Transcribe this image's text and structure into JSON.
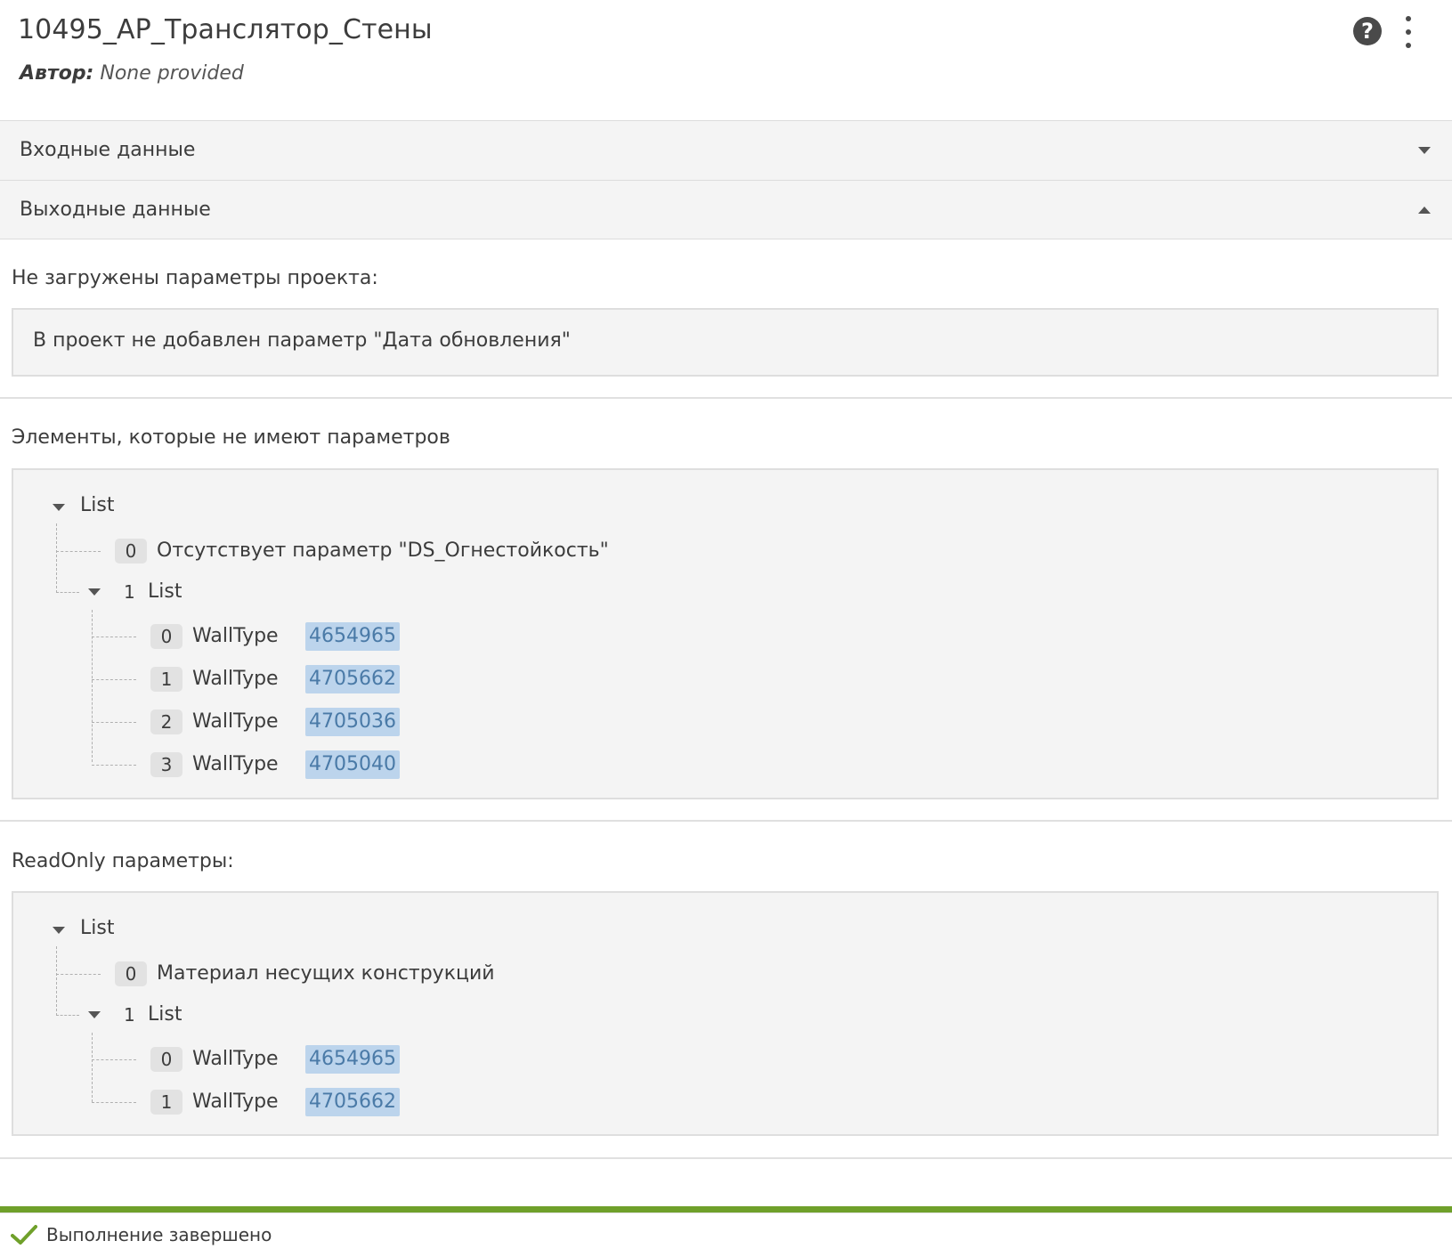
{
  "header": {
    "title": "10495_АР_Транслятор_Стены",
    "author_label": "Автор:",
    "author_value": "None provided"
  },
  "accordion": {
    "inputs_label": "Входные данные",
    "outputs_label": "Выходные данные"
  },
  "outputs": {
    "project_params": {
      "label": "Не загружены параметры проекта:",
      "value": "В проект не добавлен параметр \"Дата обновления\""
    },
    "missing_params": {
      "label": "Элементы, которые не имеют параметров",
      "root_label": "List",
      "item0_index": "0",
      "item0_text": "Отсутствует параметр \"DS_Огнестойкость\"",
      "item1_index": "1",
      "item1_label": "List",
      "children": [
        {
          "index": "0",
          "type": "WallType",
          "id": "4654965"
        },
        {
          "index": "1",
          "type": "WallType",
          "id": "4705662"
        },
        {
          "index": "2",
          "type": "WallType",
          "id": "4705036"
        },
        {
          "index": "3",
          "type": "WallType",
          "id": "4705040"
        }
      ]
    },
    "readonly_params": {
      "label": "ReadOnly параметры:",
      "root_label": "List",
      "item0_index": "0",
      "item0_text": "Материал несущих конструкций",
      "item1_index": "1",
      "item1_label": "List",
      "children": [
        {
          "index": "0",
          "type": "WallType",
          "id": "4654965"
        },
        {
          "index": "1",
          "type": "WallType",
          "id": "4705662"
        }
      ]
    }
  },
  "status": {
    "text": "Выполнение завершено",
    "progress_percent": 100,
    "color": "#6fa02a"
  },
  "colors": {
    "id_highlight": "#bcd4ec",
    "id_text": "#4a7aa7"
  }
}
